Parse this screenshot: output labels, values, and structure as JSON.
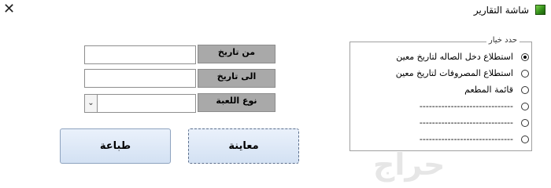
{
  "window": {
    "title": "شاشة التقارير",
    "close_glyph": "✕"
  },
  "fields": [
    {
      "label": "من تاريخ",
      "value": ""
    },
    {
      "label": "الى تاريخ",
      "value": ""
    },
    {
      "label": "نوع  اللعبة",
      "value": ""
    }
  ],
  "combo_arrow": "⌄",
  "buttons": {
    "preview_label": "معاينة",
    "print_label": "طباعة"
  },
  "options_group": {
    "legend": "حدد خيار",
    "options": [
      {
        "label": "استطلاع دخل الصاله لتاريخ معين",
        "checked": true
      },
      {
        "label": "استطلاع المصروفات لتاريخ معين",
        "checked": false
      },
      {
        "label": "قائمة المطعم",
        "checked": false
      },
      {
        "label": "------------------------------",
        "checked": false
      },
      {
        "label": "------------------------------",
        "checked": false
      },
      {
        "label": "------------------------------",
        "checked": false
      }
    ]
  },
  "watermark": "حراج"
}
